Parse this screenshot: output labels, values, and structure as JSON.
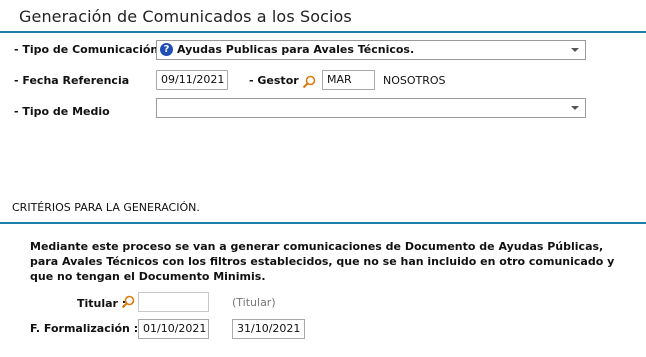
{
  "page": {
    "title": "Generación de Comunicados a los Socios"
  },
  "form": {
    "tipo_comunicacion": {
      "label": "- Tipo de Comunicación",
      "value": "Ayudas Publicas para Avales Técnicos.",
      "icon": "question-icon"
    },
    "fecha_referencia": {
      "label": "- Fecha Referencia",
      "value": "09/11/2021"
    },
    "gestor": {
      "label": "- Gestor",
      "code": "MAR",
      "name": "NOSOTROS",
      "icon": "magnifier-icon"
    },
    "tipo_medio": {
      "label": "- Tipo de Medio",
      "value": ""
    }
  },
  "criterios": {
    "heading": "CRITÉRIOS PARA LA GENERACIÓN.",
    "description": "Mediante este proceso se van a generar comunicaciones de Documento de Ayudas Públicas, para Avales Técnicos con los filtros establecidos, que no se han incluido en otro comunicado y que no tengan el Documento Minimis.",
    "titular": {
      "label": "Titular :",
      "value": "",
      "hint": "(Titular)",
      "icon": "magnifier-icon"
    },
    "formalizacion": {
      "label": "F. Formalización :",
      "from": "01/10/2021",
      "to": "31/10/2021"
    }
  },
  "colors": {
    "accent": "#1a7fa6",
    "icon_orange": "#e07a10",
    "icon_blue": "#1f4fb5"
  }
}
